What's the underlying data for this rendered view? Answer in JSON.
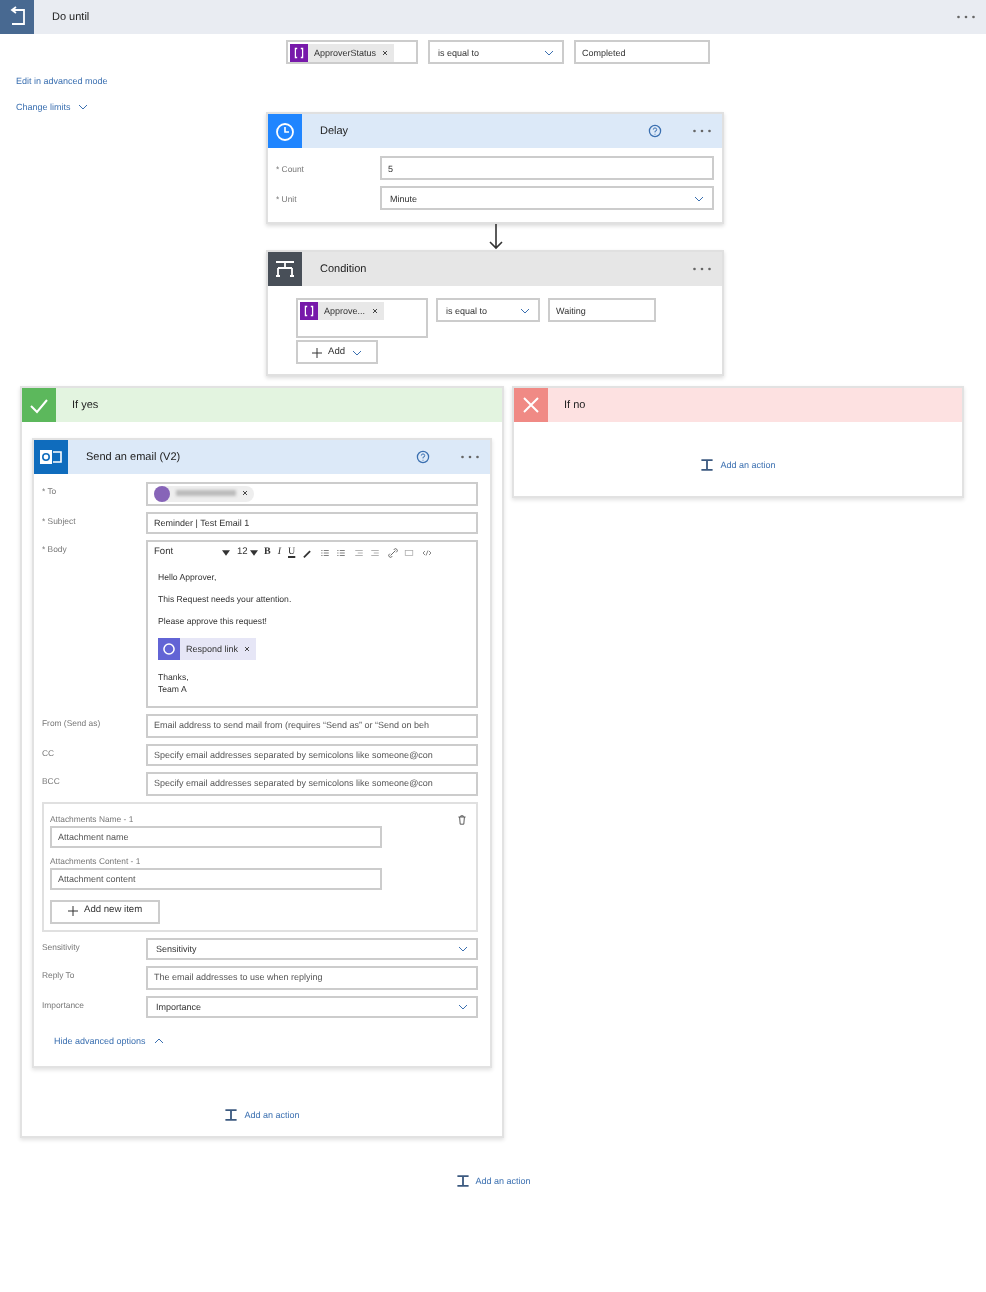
{
  "loop": {
    "title": "Do until",
    "token": "ApproverStatus",
    "operator": "is equal to",
    "value": "Completed",
    "advanced_link": "Edit in advanced mode",
    "limits_link": "Change limits"
  },
  "delay": {
    "title": "Delay",
    "fields": [
      {
        "kind": "text",
        "label": "* Count",
        "value": "5"
      },
      {
        "kind": "select",
        "label": "* Unit",
        "value": "Minute"
      }
    ]
  },
  "condition": {
    "title": "Condition",
    "token": "Approve...",
    "operator": "is equal to",
    "value": "Waiting",
    "add_button": "Add"
  },
  "branches": [
    {
      "kind": "yes",
      "title": "If yes",
      "add_action": "Add an action",
      "actions": [
        {
          "kind": "send_email",
          "title": "Send an email (V2)",
          "hide_link": "Hide advanced options",
          "fields": [
            {
              "kind": "recipient",
              "label": "* To"
            },
            {
              "kind": "text",
              "label": "* Subject",
              "value": "Reminder | Test Email 1"
            },
            {
              "kind": "editor",
              "label": "* Body",
              "font": "Font",
              "size": "12",
              "format_buttons": [
                "B",
                "I",
                "U"
              ],
              "lines": [
                "Hello Approver,",
                "This Request needs your attention.",
                "Please approve this request!"
              ],
              "token": "Respond link",
              "closing": [
                "Thanks,",
                "Team A"
              ]
            },
            {
              "kind": "text",
              "label": "From (Send as)",
              "placeholder": "Email address to send mail from (requires “Send as” or “Send on beh"
            },
            {
              "kind": "text",
              "label": "CC",
              "placeholder": "Specify email addresses separated by semicolons like someone@con"
            },
            {
              "kind": "text",
              "label": "BCC",
              "placeholder": "Specify email addresses separated by semicolons like someone@con"
            },
            {
              "kind": "attachments",
              "add_button": "Add new item",
              "items": [
                {
                  "label": "Attachments Name - 1",
                  "placeholder": "Attachment name"
                },
                {
                  "label": "Attachments Content - 1",
                  "placeholder": "Attachment content"
                }
              ]
            },
            {
              "kind": "select",
              "label": "Sensitivity",
              "placeholder": "Sensitivity"
            },
            {
              "kind": "text",
              "label": "Reply To",
              "placeholder": "The email addresses to use when replying"
            },
            {
              "kind": "select",
              "label": "Importance",
              "placeholder": "Importance"
            }
          ]
        }
      ]
    },
    {
      "kind": "no",
      "title": "If no",
      "add_action": "Add an action"
    }
  ],
  "add_action": "Add an action"
}
